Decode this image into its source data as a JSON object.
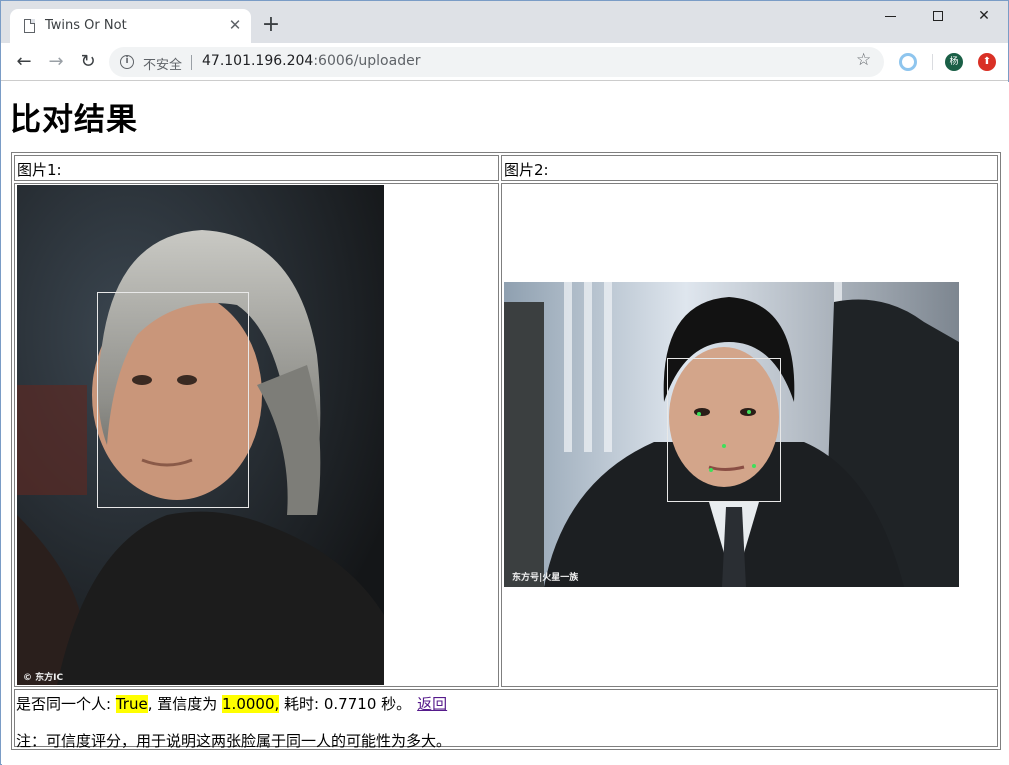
{
  "browser": {
    "tab_title": "Twins Or Not",
    "insecure_label": "不安全",
    "url_host": "47.101.196.204",
    "url_rest": ":6006/uploader",
    "profile_initial": "杨"
  },
  "page": {
    "title": "比对结果",
    "image1_label": "图片1:",
    "image2_label": "图片2:",
    "image1_watermark": "© 东方IC",
    "image2_watermark": "东方号|火星一族",
    "result": {
      "same_person_label": "是否同一个人: ",
      "same_person_value": "True",
      "confidence_label": ", 置信度为 ",
      "confidence_value": "1.0000,",
      "time_text": " 耗时: 0.7710 秒。",
      "back_link": "返回"
    },
    "note": "注：可信度评分，用于说明这两张脸属于同一人的可能性为多大。"
  }
}
